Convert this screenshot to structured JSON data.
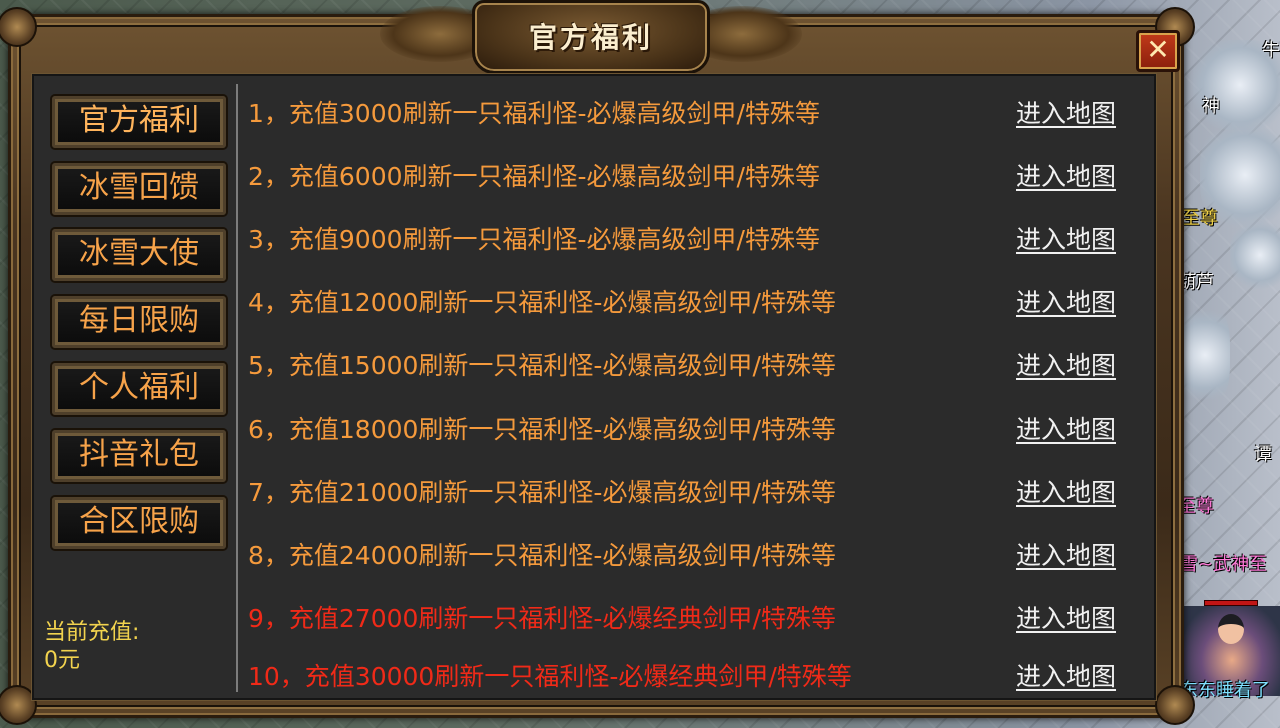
{
  "window": {
    "title": "官方福利",
    "close_label": "✕"
  },
  "menu": [
    {
      "label": "官方福利"
    },
    {
      "label": "冰雪回馈"
    },
    {
      "label": "冰雪大使"
    },
    {
      "label": "每日限购"
    },
    {
      "label": "个人福利"
    },
    {
      "label": "抖音礼包"
    },
    {
      "label": "合区限购"
    }
  ],
  "recharge": {
    "label": "当前充值:",
    "value": "0元"
  },
  "rows": [
    {
      "text": "1，充值3000刷新一只福利怪-必爆高级剑甲/特殊等",
      "link": "进入地图",
      "color": "orange"
    },
    {
      "text": "2，充值6000刷新一只福利怪-必爆高级剑甲/特殊等",
      "link": "进入地图",
      "color": "orange"
    },
    {
      "text": "3，充值9000刷新一只福利怪-必爆高级剑甲/特殊等",
      "link": "进入地图",
      "color": "orange"
    },
    {
      "text": "4，充值12000刷新一只福利怪-必爆高级剑甲/特殊等",
      "link": "进入地图",
      "color": "orange"
    },
    {
      "text": "5，充值15000刷新一只福利怪-必爆高级剑甲/特殊等",
      "link": "进入地图",
      "color": "orange"
    },
    {
      "text": "6，充值18000刷新一只福利怪-必爆高级剑甲/特殊等",
      "link": "进入地图",
      "color": "orange"
    },
    {
      "text": "7，充值21000刷新一只福利怪-必爆高级剑甲/特殊等",
      "link": "进入地图",
      "color": "orange"
    },
    {
      "text": "8，充值24000刷新一只福利怪-必爆高级剑甲/特殊等",
      "link": "进入地图",
      "color": "orange"
    },
    {
      "text": "9，充值27000刷新一只福利怪-必爆经典剑甲/特殊等",
      "link": "进入地图",
      "color": "red"
    },
    {
      "text": "10，充值30000刷新一只福利怪-必爆经典剑甲/特殊等",
      "link": "进入地图",
      "color": "red"
    }
  ],
  "world_labels": [
    {
      "text": "牛",
      "style": "white"
    },
    {
      "text": "神",
      "style": "white"
    },
    {
      "text": "至尊",
      "style": "gold"
    },
    {
      "text": "葫芦",
      "style": "white"
    },
    {
      "text": "谭",
      "style": "white"
    },
    {
      "text": "至尊",
      "style": "pink"
    },
    {
      "text": "雪~武神至",
      "style": "pink"
    },
    {
      "text": "东东睡着了",
      "style": "cyan"
    }
  ],
  "colors": {
    "row_orange": "#f59a3c",
    "row_red": "#f02a18",
    "menu_text": "#f7a34a",
    "recharge_text": "#f2d34e",
    "link_text": "#f1f1f1"
  }
}
